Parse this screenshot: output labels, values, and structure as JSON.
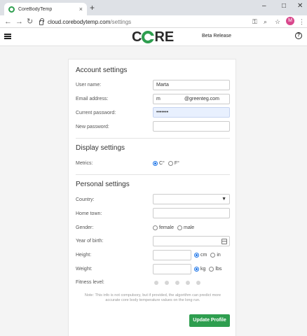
{
  "browser": {
    "tab_title": "CoreBodyTemp",
    "tab_close": "×",
    "new_tab": "+",
    "url_host": "cloud.corebodytemp.com",
    "url_path": "/settings",
    "profile_initial": "M",
    "window_controls": {
      "minimize": "–",
      "maximize": "□",
      "close": "✕"
    },
    "nav": {
      "back": "←",
      "forward": "→",
      "reload": "↻"
    },
    "toolbar_icons": {
      "key": "⚿",
      "zoom": "⌕",
      "star": "☆",
      "menu": "⋮"
    }
  },
  "app": {
    "logo_left": "C",
    "logo_right": "RE",
    "beta_label": "Beta Release",
    "help": "?",
    "brand_color": "#2e9e4f"
  },
  "account": {
    "title": "Account settings",
    "user_name_label": "User name:",
    "user_name_value": "Marta",
    "email_label": "Email address:",
    "email_local": "m",
    "email_domain": "@greenteg.com",
    "current_password_label": "Current password:",
    "current_password_value": "•••••••",
    "new_password_label": "New password:",
    "new_password_value": ""
  },
  "display": {
    "title": "Display settings",
    "metrics_label": "Metrics:",
    "metrics_options": [
      "C°",
      "F°"
    ],
    "metrics_selected": "C°"
  },
  "personal": {
    "title": "Personal settings",
    "country_label": "Country:",
    "country_value": "",
    "hometown_label": "Home town:",
    "hometown_value": "",
    "gender_label": "Gender:",
    "gender_options": [
      "female",
      "male"
    ],
    "year_label": "Year of birth:",
    "year_value": "",
    "height_label": "Height:",
    "height_units": [
      "cm",
      "in"
    ],
    "height_selected": "cm",
    "weight_label": "Weight:",
    "weight_units": [
      "kg",
      "lbs"
    ],
    "weight_selected": "kg",
    "fitness_label": "Fitness level:",
    "fitness_levels": 5,
    "note": "Note: This info is not compulsory, but if provided, the algorithm can predict more accurate core body temperature values on the long run.",
    "update_button": "Update Profile"
  }
}
